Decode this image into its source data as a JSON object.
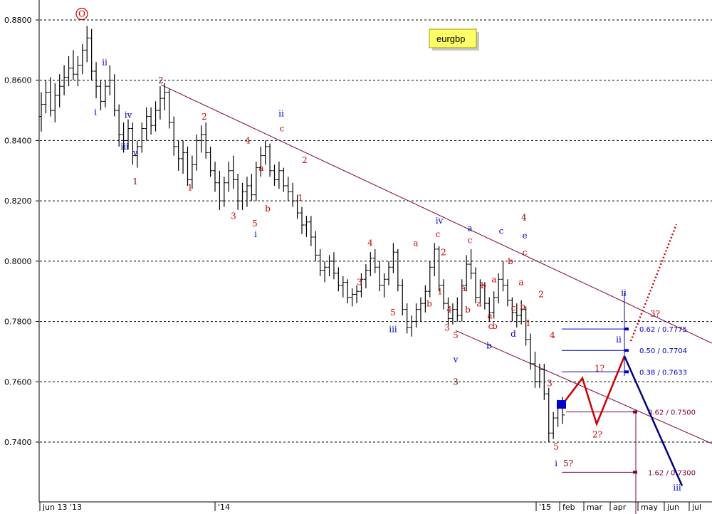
{
  "chart_data": {
    "type": "bar",
    "symbol": "eurgbp",
    "y_axis": {
      "range": [
        0.7225,
        0.884
      ],
      "ticks": [
        "0.8800",
        "0.8600",
        "0.8400",
        "0.8200",
        "0.8000",
        "0.7800",
        "0.7600",
        "0.7400"
      ],
      "grid": "dashed"
    },
    "x_axis": {
      "ticks": [
        "jun 13 '13",
        "'14",
        "'15",
        "feb",
        "mar",
        "apr",
        "may",
        "jun",
        "jul"
      ]
    },
    "bar_count": 123,
    "bars": [
      {
        "o": 0.848,
        "h": 0.856,
        "l": 0.843,
        "c": 0.852
      },
      {
        "o": 0.852,
        "h": 0.86,
        "l": 0.849,
        "c": 0.856
      },
      {
        "o": 0.856,
        "h": 0.861,
        "l": 0.848,
        "c": 0.85
      },
      {
        "o": 0.85,
        "h": 0.859,
        "l": 0.846,
        "c": 0.855
      },
      {
        "o": 0.855,
        "h": 0.862,
        "l": 0.851,
        "c": 0.858
      },
      {
        "o": 0.858,
        "h": 0.865,
        "l": 0.855,
        "c": 0.861
      },
      {
        "o": 0.861,
        "h": 0.868,
        "l": 0.858,
        "c": 0.864
      },
      {
        "o": 0.864,
        "h": 0.87,
        "l": 0.86,
        "c": 0.862
      },
      {
        "o": 0.862,
        "h": 0.868,
        "l": 0.858,
        "c": 0.865
      },
      {
        "o": 0.865,
        "h": 0.872,
        "l": 0.862,
        "c": 0.87
      },
      {
        "o": 0.87,
        "h": 0.878,
        "l": 0.866,
        "c": 0.874
      },
      {
        "o": 0.874,
        "h": 0.877,
        "l": 0.86,
        "c": 0.863
      },
      {
        "o": 0.863,
        "h": 0.866,
        "l": 0.854,
        "c": 0.858
      },
      {
        "o": 0.858,
        "h": 0.86,
        "l": 0.85,
        "c": 0.853
      },
      {
        "o": 0.853,
        "h": 0.86,
        "l": 0.851,
        "c": 0.858
      },
      {
        "o": 0.858,
        "h": 0.865,
        "l": 0.855,
        "c": 0.86
      },
      {
        "o": 0.86,
        "h": 0.862,
        "l": 0.848,
        "c": 0.85
      },
      {
        "o": 0.85,
        "h": 0.852,
        "l": 0.838,
        "c": 0.842
      },
      {
        "o": 0.842,
        "h": 0.846,
        "l": 0.836,
        "c": 0.84
      },
      {
        "o": 0.84,
        "h": 0.847,
        "l": 0.837,
        "c": 0.844
      },
      {
        "o": 0.844,
        "h": 0.846,
        "l": 0.832,
        "c": 0.835
      },
      {
        "o": 0.835,
        "h": 0.84,
        "l": 0.831,
        "c": 0.838
      },
      {
        "o": 0.838,
        "h": 0.846,
        "l": 0.836,
        "c": 0.844
      },
      {
        "o": 0.844,
        "h": 0.851,
        "l": 0.84,
        "c": 0.848
      },
      {
        "o": 0.848,
        "h": 0.851,
        "l": 0.842,
        "c": 0.845
      },
      {
        "o": 0.845,
        "h": 0.853,
        "l": 0.843,
        "c": 0.85
      },
      {
        "o": 0.85,
        "h": 0.858,
        "l": 0.847,
        "c": 0.854
      },
      {
        "o": 0.854,
        "h": 0.859,
        "l": 0.85,
        "c": 0.856
      },
      {
        "o": 0.856,
        "h": 0.857,
        "l": 0.844,
        "c": 0.846
      },
      {
        "o": 0.846,
        "h": 0.848,
        "l": 0.835,
        "c": 0.838
      },
      {
        "o": 0.838,
        "h": 0.84,
        "l": 0.83,
        "c": 0.834
      },
      {
        "o": 0.834,
        "h": 0.84,
        "l": 0.829,
        "c": 0.836
      },
      {
        "o": 0.836,
        "h": 0.838,
        "l": 0.825,
        "c": 0.827
      },
      {
        "o": 0.827,
        "h": 0.835,
        "l": 0.824,
        "c": 0.832
      },
      {
        "o": 0.832,
        "h": 0.842,
        "l": 0.83,
        "c": 0.84
      },
      {
        "o": 0.84,
        "h": 0.845,
        "l": 0.836,
        "c": 0.842
      },
      {
        "o": 0.842,
        "h": 0.846,
        "l": 0.834,
        "c": 0.836
      },
      {
        "o": 0.836,
        "h": 0.838,
        "l": 0.828,
        "c": 0.83
      },
      {
        "o": 0.83,
        "h": 0.833,
        "l": 0.823,
        "c": 0.826
      },
      {
        "o": 0.826,
        "h": 0.83,
        "l": 0.817,
        "c": 0.82
      },
      {
        "o": 0.82,
        "h": 0.828,
        "l": 0.818,
        "c": 0.826
      },
      {
        "o": 0.826,
        "h": 0.833,
        "l": 0.823,
        "c": 0.83
      },
      {
        "o": 0.83,
        "h": 0.835,
        "l": 0.824,
        "c": 0.827
      },
      {
        "o": 0.827,
        "h": 0.829,
        "l": 0.817,
        "c": 0.82
      },
      {
        "o": 0.82,
        "h": 0.826,
        "l": 0.817,
        "c": 0.823
      },
      {
        "o": 0.823,
        "h": 0.828,
        "l": 0.818,
        "c": 0.825
      },
      {
        "o": 0.825,
        "h": 0.829,
        "l": 0.82,
        "c": 0.822
      },
      {
        "o": 0.822,
        "h": 0.833,
        "l": 0.82,
        "c": 0.831
      },
      {
        "o": 0.831,
        "h": 0.838,
        "l": 0.828,
        "c": 0.835
      },
      {
        "o": 0.835,
        "h": 0.84,
        "l": 0.832,
        "c": 0.838
      },
      {
        "o": 0.838,
        "h": 0.839,
        "l": 0.828,
        "c": 0.83
      },
      {
        "o": 0.83,
        "h": 0.832,
        "l": 0.825,
        "c": 0.827
      },
      {
        "o": 0.827,
        "h": 0.833,
        "l": 0.824,
        "c": 0.83
      },
      {
        "o": 0.83,
        "h": 0.831,
        "l": 0.823,
        "c": 0.825
      },
      {
        "o": 0.825,
        "h": 0.828,
        "l": 0.82,
        "c": 0.823
      },
      {
        "o": 0.823,
        "h": 0.826,
        "l": 0.818,
        "c": 0.82
      },
      {
        "o": 0.82,
        "h": 0.822,
        "l": 0.814,
        "c": 0.816
      },
      {
        "o": 0.816,
        "h": 0.818,
        "l": 0.809,
        "c": 0.812
      },
      {
        "o": 0.812,
        "h": 0.815,
        "l": 0.808,
        "c": 0.813
      },
      {
        "o": 0.813,
        "h": 0.815,
        "l": 0.805,
        "c": 0.808
      },
      {
        "o": 0.808,
        "h": 0.81,
        "l": 0.8,
        "c": 0.802
      },
      {
        "o": 0.802,
        "h": 0.804,
        "l": 0.795,
        "c": 0.797
      },
      {
        "o": 0.797,
        "h": 0.8,
        "l": 0.793,
        "c": 0.798
      },
      {
        "o": 0.798,
        "h": 0.802,
        "l": 0.795,
        "c": 0.8
      },
      {
        "o": 0.8,
        "h": 0.803,
        "l": 0.794,
        "c": 0.796
      },
      {
        "o": 0.796,
        "h": 0.798,
        "l": 0.79,
        "c": 0.792
      },
      {
        "o": 0.792,
        "h": 0.795,
        "l": 0.788,
        "c": 0.793
      },
      {
        "o": 0.793,
        "h": 0.794,
        "l": 0.786,
        "c": 0.788
      },
      {
        "o": 0.788,
        "h": 0.791,
        "l": 0.785,
        "c": 0.789
      },
      {
        "o": 0.789,
        "h": 0.792,
        "l": 0.786,
        "c": 0.79
      },
      {
        "o": 0.79,
        "h": 0.796,
        "l": 0.788,
        "c": 0.794
      },
      {
        "o": 0.794,
        "h": 0.799,
        "l": 0.791,
        "c": 0.797
      },
      {
        "o": 0.797,
        "h": 0.803,
        "l": 0.795,
        "c": 0.801
      },
      {
        "o": 0.801,
        "h": 0.804,
        "l": 0.796,
        "c": 0.798
      },
      {
        "o": 0.798,
        "h": 0.8,
        "l": 0.79,
        "c": 0.792
      },
      {
        "o": 0.792,
        "h": 0.796,
        "l": 0.788,
        "c": 0.794
      },
      {
        "o": 0.794,
        "h": 0.8,
        "l": 0.792,
        "c": 0.798
      },
      {
        "o": 0.798,
        "h": 0.806,
        "l": 0.796,
        "c": 0.803
      },
      {
        "o": 0.803,
        "h": 0.804,
        "l": 0.79,
        "c": 0.792
      },
      {
        "o": 0.792,
        "h": 0.794,
        "l": 0.782,
        "c": 0.784
      },
      {
        "o": 0.784,
        "h": 0.786,
        "l": 0.776,
        "c": 0.778
      },
      {
        "o": 0.778,
        "h": 0.782,
        "l": 0.775,
        "c": 0.78
      },
      {
        "o": 0.78,
        "h": 0.786,
        "l": 0.778,
        "c": 0.784
      },
      {
        "o": 0.784,
        "h": 0.788,
        "l": 0.78,
        "c": 0.786
      },
      {
        "o": 0.786,
        "h": 0.792,
        "l": 0.783,
        "c": 0.79
      },
      {
        "o": 0.79,
        "h": 0.8,
        "l": 0.788,
        "c": 0.798
      },
      {
        "o": 0.798,
        "h": 0.806,
        "l": 0.795,
        "c": 0.804
      },
      {
        "o": 0.804,
        "h": 0.805,
        "l": 0.79,
        "c": 0.792
      },
      {
        "o": 0.792,
        "h": 0.794,
        "l": 0.784,
        "c": 0.786
      },
      {
        "o": 0.786,
        "h": 0.788,
        "l": 0.779,
        "c": 0.781
      },
      {
        "o": 0.781,
        "h": 0.786,
        "l": 0.779,
        "c": 0.784
      },
      {
        "o": 0.784,
        "h": 0.788,
        "l": 0.78,
        "c": 0.782
      },
      {
        "o": 0.782,
        "h": 0.794,
        "l": 0.78,
        "c": 0.792
      },
      {
        "o": 0.792,
        "h": 0.802,
        "l": 0.79,
        "c": 0.799
      },
      {
        "o": 0.799,
        "h": 0.804,
        "l": 0.794,
        "c": 0.796
      },
      {
        "o": 0.796,
        "h": 0.798,
        "l": 0.786,
        "c": 0.788
      },
      {
        "o": 0.788,
        "h": 0.794,
        "l": 0.786,
        "c": 0.792
      },
      {
        "o": 0.792,
        "h": 0.793,
        "l": 0.784,
        "c": 0.786
      },
      {
        "o": 0.786,
        "h": 0.788,
        "l": 0.78,
        "c": 0.783
      },
      {
        "o": 0.783,
        "h": 0.79,
        "l": 0.781,
        "c": 0.788
      },
      {
        "o": 0.788,
        "h": 0.796,
        "l": 0.786,
        "c": 0.794
      },
      {
        "o": 0.794,
        "h": 0.8,
        "l": 0.79,
        "c": 0.792
      },
      {
        "o": 0.792,
        "h": 0.794,
        "l": 0.785,
        "c": 0.787
      },
      {
        "o": 0.787,
        "h": 0.788,
        "l": 0.78,
        "c": 0.783
      },
      {
        "o": 0.783,
        "h": 0.786,
        "l": 0.778,
        "c": 0.782
      },
      {
        "o": 0.782,
        "h": 0.787,
        "l": 0.779,
        "c": 0.784
      },
      {
        "o": 0.784,
        "h": 0.785,
        "l": 0.772,
        "c": 0.774
      },
      {
        "o": 0.774,
        "h": 0.776,
        "l": 0.764,
        "c": 0.766
      },
      {
        "o": 0.766,
        "h": 0.77,
        "l": 0.758,
        "c": 0.76
      },
      {
        "o": 0.76,
        "h": 0.766,
        "l": 0.758,
        "c": 0.764
      },
      {
        "o": 0.764,
        "h": 0.766,
        "l": 0.754,
        "c": 0.756
      },
      {
        "o": 0.756,
        "h": 0.758,
        "l": 0.74,
        "c": 0.743
      },
      {
        "o": 0.743,
        "h": 0.75,
        "l": 0.741,
        "c": 0.748
      },
      {
        "o": 0.748,
        "h": 0.754,
        "l": 0.745,
        "c": 0.752
      },
      {
        "o": 0.752,
        "h": 0.755,
        "l": 0.746,
        "c": 0.749
      }
    ],
    "channel_lines": [
      {
        "color": "#800040",
        "from": [
          "2013-10-01",
          0.8585
        ],
        "to": [
          "2015-07-31",
          0.7728
        ]
      },
      {
        "color": "#800040",
        "from": [
          "2014-09-01",
          0.777
        ],
        "to": [
          "2015-07-31",
          0.7395
        ]
      }
    ],
    "projections": [
      {
        "color": "#cc0000",
        "style": "solid",
        "points": [
          0.7525,
          0.7612,
          0.746,
          0.7685
        ]
      },
      {
        "color": "#000080",
        "style": "solid",
        "points": [
          0.7685,
          0.7255
        ]
      },
      {
        "color": "#cc0000",
        "style": "dotted",
        "points": [
          0.7735,
          0.8122
        ]
      }
    ],
    "fib_levels": [
      {
        "label": "0.62 / 0.7775",
        "value": 0.7775,
        "color": "#0000cc"
      },
      {
        "label": "0.50 / 0.7704",
        "value": 0.7704,
        "color": "#0000cc"
      },
      {
        "label": "0.38 / 0.7633",
        "value": 0.7633,
        "color": "#0000cc"
      },
      {
        "label": "0.62 / 0.7500",
        "value": 0.75,
        "color": "#800040"
      },
      {
        "label": "1.62 / 0.7300",
        "value": 0.73,
        "color": "#800040"
      }
    ],
    "wave_labels": [
      {
        "text": "ii",
        "color": "#0000cc",
        "value": 0.865
      },
      {
        "text": "i",
        "color": "#0000cc",
        "value": 0.8485
      },
      {
        "text": "iv",
        "color": "#0000cc",
        "value": 0.8475
      },
      {
        "text": "iii",
        "color": "#0000cc",
        "value": 0.837
      },
      {
        "text": "v",
        "color": "#0000cc",
        "value": 0.835
      },
      {
        "text": "1",
        "color": "#800000",
        "value": 0.8255
      },
      {
        "text": "2",
        "color": "#800000",
        "value": 0.859
      },
      {
        "text": "1",
        "color": "#cc0000",
        "value": 0.8235
      },
      {
        "text": "2",
        "color": "#cc0000",
        "value": 0.847
      },
      {
        "text": "3",
        "color": "#cc0000",
        "value": 0.814
      },
      {
        "text": "4",
        "color": "#cc0000",
        "value": 0.839
      },
      {
        "text": "a",
        "color": "#cc0000",
        "value": 0.83
      },
      {
        "text": "5",
        "color": "#cc0000",
        "value": 0.8115
      },
      {
        "text": "b",
        "color": "#cc0000",
        "value": 0.8165
      },
      {
        "text": "i",
        "color": "#0000cc",
        "value": 0.808
      },
      {
        "text": "ii",
        "color": "#0000cc",
        "value": 0.848
      },
      {
        "text": "c",
        "color": "#cc0000",
        "value": 0.843
      },
      {
        "text": "2",
        "color": "#cc0000",
        "value": 0.8325
      },
      {
        "text": "1",
        "color": "#cc0000",
        "value": 0.82
      },
      {
        "text": "4",
        "color": "#cc0000",
        "value": 0.805
      },
      {
        "text": "3",
        "color": "#cc0000",
        "value": 0.792
      },
      {
        "text": "a",
        "color": "#cc0000",
        "value": 0.805
      },
      {
        "text": "5",
        "color": "#cc0000",
        "value": 0.782
      },
      {
        "text": "iii",
        "color": "#0000cc",
        "value": 0.7765
      },
      {
        "text": "b",
        "color": "#cc0000",
        "value": 0.785
      },
      {
        "text": "c",
        "color": "#cc0000",
        "value": 0.808
      },
      {
        "text": "2",
        "color": "#cc0000",
        "value": 0.802
      },
      {
        "text": "1",
        "color": "#cc0000",
        "value": 0.789
      },
      {
        "text": "4",
        "color": "#cc0000",
        "value": 0.783
      },
      {
        "text": "3",
        "color": "#cc0000",
        "value": 0.777
      },
      {
        "text": "5",
        "color": "#cc0000",
        "value": 0.7745
      },
      {
        "text": "iv",
        "color": "#0000cc",
        "value": 0.8125
      },
      {
        "text": "v",
        "color": "#0000cc",
        "value": 0.7665
      },
      {
        "text": "3",
        "color": "#800000",
        "value": 0.759
      },
      {
        "text": "a",
        "color": "#0000cc",
        "value": 0.81
      },
      {
        "text": "c",
        "color": "#cc0000",
        "value": 0.806
      },
      {
        "text": "a",
        "color": "#cc0000",
        "value": 0.79
      },
      {
        "text": "b",
        "color": "#cc0000",
        "value": 0.783
      },
      {
        "text": "a",
        "color": "#cc0000",
        "value": 0.785
      },
      {
        "text": "b",
        "color": "#cc0000",
        "value": 0.791
      },
      {
        "text": "a",
        "color": "#cc0000",
        "value": 0.781
      },
      {
        "text": "c",
        "color": "#cc0000",
        "value": 0.7775
      },
      {
        "text": "b",
        "color": "#cc0000",
        "value": 0.7775
      },
      {
        "text": "b",
        "color": "#0000cc",
        "value": 0.771
      },
      {
        "text": "c",
        "color": "#0000cc",
        "value": 0.809
      },
      {
        "text": "b",
        "color": "#cc0000",
        "value": 0.799
      },
      {
        "text": "a",
        "color": "#cc0000",
        "value": 0.793
      },
      {
        "text": "c",
        "color": "#cc0000",
        "value": 0.7835
      },
      {
        "text": "d",
        "color": "#0000cc",
        "value": 0.775
      },
      {
        "text": "4",
        "color": "#800000",
        "value": 0.8135
      },
      {
        "text": "e",
        "color": "#0000cc",
        "value": 0.8075
      },
      {
        "text": "c",
        "color": "#cc0000",
        "value": 0.802
      },
      {
        "text": "a",
        "color": "#cc0000",
        "value": 0.792
      },
      {
        "text": "b",
        "color": "#cc0000",
        "value": 0.784
      },
      {
        "text": "1",
        "color": "#cc0000",
        "value": 0.7785
      },
      {
        "text": "2",
        "color": "#cc0000",
        "value": 0.788
      },
      {
        "text": "4",
        "color": "#cc0000",
        "value": 0.7745
      },
      {
        "text": "3",
        "color": "#cc0000",
        "value": 0.7585
      },
      {
        "text": "5",
        "color": "#cc0000",
        "value": 0.7375
      },
      {
        "text": "i",
        "color": "#0000cc",
        "value": 0.732
      },
      {
        "text": "5?",
        "color": "#800000",
        "value": 0.732
      },
      {
        "text": "1?",
        "color": "#cc0000",
        "value": 0.7635
      },
      {
        "text": "2?",
        "color": "#cc0000",
        "value": 0.7415
      },
      {
        "text": "ii",
        "color": "#0000cc",
        "value": 0.7885
      },
      {
        "text": "ii",
        "color": "#0000cc",
        "value": 0.773
      },
      {
        "text": "3?",
        "color": "#cc0000",
        "value": 0.7815
      },
      {
        "text": "iii",
        "color": "#0000cc",
        "value": 0.724
      }
    ],
    "top_marker": {
      "text": "O",
      "value": 0.882,
      "color": "#cc0000"
    },
    "current_marker": {
      "value": 0.7525,
      "color": "#0000cc"
    }
  }
}
